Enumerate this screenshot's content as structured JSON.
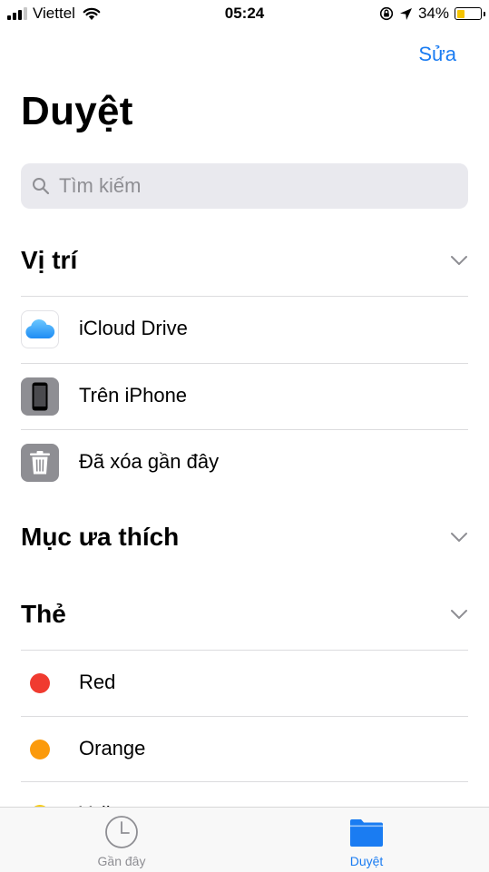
{
  "status": {
    "carrier": "Viettel",
    "time": "05:24",
    "battery_percent": "34%",
    "battery_level": 0.34
  },
  "nav": {
    "edit_label": "Sửa"
  },
  "page_title": "Duyệt",
  "search": {
    "placeholder": "Tìm kiếm"
  },
  "sections": {
    "locations": {
      "title": "Vị trí",
      "items": [
        {
          "label": "iCloud Drive",
          "icon": "icloud-icon"
        },
        {
          "label": "Trên iPhone",
          "icon": "iphone-icon"
        },
        {
          "label": "Đã xóa gần đây",
          "icon": "trash-icon"
        }
      ]
    },
    "favorites": {
      "title": "Mục ưa thích"
    },
    "tags": {
      "title": "Thẻ",
      "items": [
        {
          "label": "Red",
          "color": "#f03b30"
        },
        {
          "label": "Orange",
          "color": "#fb9a0c"
        },
        {
          "label": "Yellow",
          "color": "#f7cc15"
        }
      ]
    }
  },
  "tabs": [
    {
      "label": "Gần đây",
      "icon": "clock-icon",
      "active": false
    },
    {
      "label": "Duyệt",
      "icon": "folder-icon",
      "active": true
    }
  ],
  "colors": {
    "accent": "#1a7cf2",
    "inactive": "#8e8e93"
  }
}
